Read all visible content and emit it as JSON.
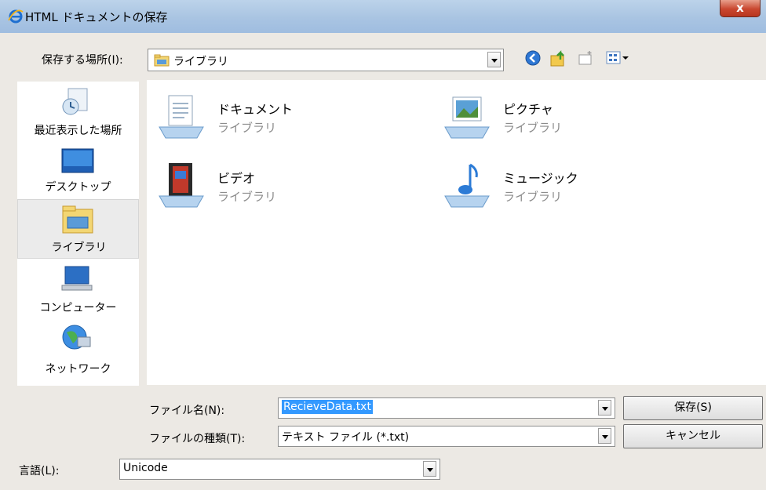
{
  "window": {
    "title": "HTML ドキュメントの保存",
    "close_label": "x"
  },
  "location": {
    "label": "保存する場所(I):",
    "value": "ライブラリ"
  },
  "sidebar": {
    "items": [
      {
        "label": "最近表示した場所",
        "icon": "recent-places-icon"
      },
      {
        "label": "デスクトップ",
        "icon": "desktop-icon"
      },
      {
        "label": "ライブラリ",
        "icon": "library-icon",
        "selected": true
      },
      {
        "label": "コンピューター",
        "icon": "computer-icon"
      },
      {
        "label": "ネットワーク",
        "icon": "network-icon"
      }
    ]
  },
  "libraries": [
    {
      "name": "ドキュメント",
      "sub": "ライブラリ",
      "icon": "documents-library-icon"
    },
    {
      "name": "ピクチャ",
      "sub": "ライブラリ",
      "icon": "pictures-library-icon"
    },
    {
      "name": "ビデオ",
      "sub": "ライブラリ",
      "icon": "videos-library-icon"
    },
    {
      "name": "ミュージック",
      "sub": "ライブラリ",
      "icon": "music-library-icon"
    }
  ],
  "filename": {
    "label": "ファイル名(N):",
    "value": "RecieveData.txt"
  },
  "filetype": {
    "label": "ファイルの種類(T):",
    "value": "テキスト ファイル (*.txt)"
  },
  "language": {
    "label": "言語(L):",
    "value": "Unicode"
  },
  "buttons": {
    "save": "保存(S)",
    "cancel": "キャンセル"
  },
  "colors": {
    "selection": "#3399ff",
    "titlebar": "#a9c4e2",
    "close": "#c9472f"
  }
}
